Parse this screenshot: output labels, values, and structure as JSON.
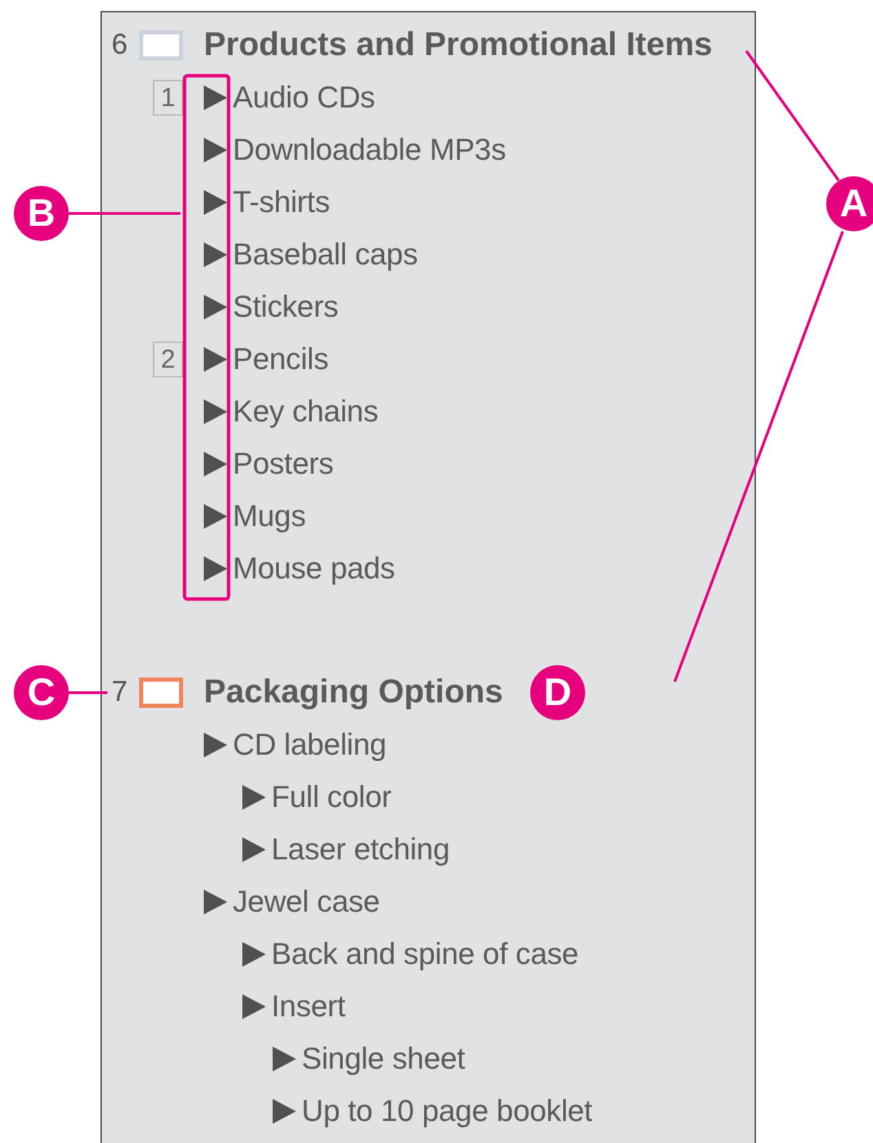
{
  "slides": [
    {
      "number": "6",
      "title": "Products and Promotional Items",
      "selected": false,
      "items": [
        {
          "text": "Audio CDs",
          "marker": "1"
        },
        {
          "text": "Downloadable MP3s"
        },
        {
          "text": "T-shirts"
        },
        {
          "text": "Baseball caps"
        },
        {
          "text": "Stickers"
        },
        {
          "text": "Pencils",
          "marker": "2"
        },
        {
          "text": "Key chains"
        },
        {
          "text": "Posters"
        },
        {
          "text": "Mugs"
        },
        {
          "text": "Mouse pads"
        }
      ]
    },
    {
      "number": "7",
      "title": "Packaging Options",
      "selected": true,
      "items": [
        {
          "text": "CD labeling",
          "children": [
            {
              "text": "Full color"
            },
            {
              "text": "Laser etching"
            }
          ]
        },
        {
          "text": "Jewel case",
          "children": [
            {
              "text": "Back and spine of case"
            },
            {
              "text": "Insert",
              "children": [
                {
                  "text": "Single sheet"
                },
                {
                  "text": "Up to 10 page booklet"
                }
              ]
            }
          ]
        }
      ]
    }
  ],
  "callouts": [
    {
      "label": "B"
    },
    {
      "label": "A"
    },
    {
      "label": "C"
    },
    {
      "label": "D"
    }
  ]
}
